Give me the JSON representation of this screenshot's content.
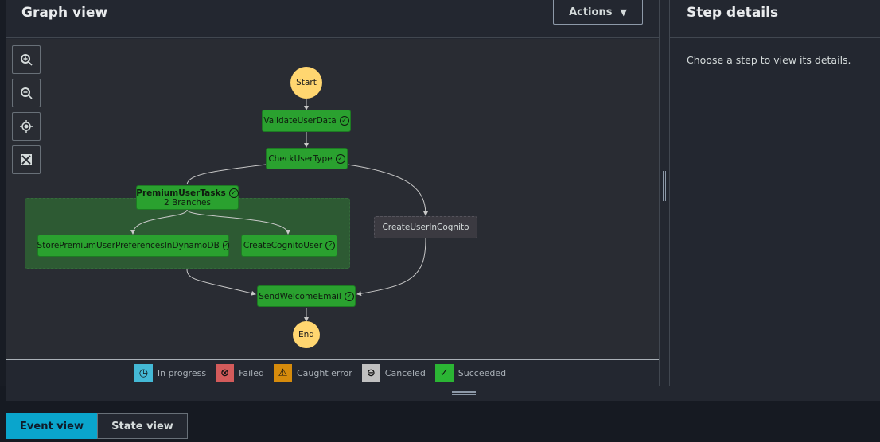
{
  "graph": {
    "title": "Graph view",
    "actions_label": "Actions",
    "controls": [
      "zoom-in",
      "zoom-out",
      "center",
      "fit"
    ],
    "nodes": {
      "start": "Start",
      "validate": "ValidateUserData",
      "check": "CheckUserType",
      "premium": "PremiumUserTasks",
      "premium_sub": "2 Branches",
      "store": "StorePremiumUserPreferencesInDynamoDB",
      "create_cognito": "CreateCognitoUser",
      "create_in_cognito": "CreateUserInCognito",
      "send": "SendWelcomeEmail",
      "end": "End"
    },
    "legend": [
      {
        "label": "In progress",
        "icon": "clock-icon",
        "color": "#44b9d6"
      },
      {
        "label": "Failed",
        "icon": "x-circle-icon",
        "color": "#d35b5b"
      },
      {
        "label": "Caught error",
        "icon": "warning-icon",
        "color": "#d68b0c"
      },
      {
        "label": "Canceled",
        "icon": "minus-circle-icon",
        "color": "#c0c0c0"
      },
      {
        "label": "Succeeded",
        "icon": "check-circle-icon",
        "color": "#2bb534"
      }
    ]
  },
  "details": {
    "title": "Step details",
    "empty_text": "Choose a step to view its details."
  },
  "tabs": [
    {
      "label": "Event view",
      "active": true,
      "color": "#0aa5cc"
    },
    {
      "label": "State view",
      "active": false
    }
  ]
}
